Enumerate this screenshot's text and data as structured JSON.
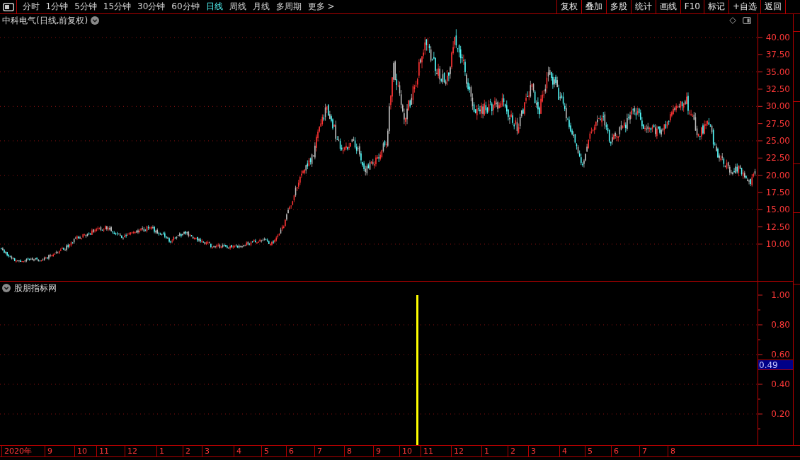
{
  "toolbar": {
    "tabs": [
      {
        "label": "分时",
        "selected": false
      },
      {
        "label": "1分钟",
        "selected": false
      },
      {
        "label": "5分钟",
        "selected": false
      },
      {
        "label": "15分钟",
        "selected": false
      },
      {
        "label": "30分钟",
        "selected": false
      },
      {
        "label": "60分钟",
        "selected": false
      },
      {
        "label": "日线",
        "selected": true
      },
      {
        "label": "周线",
        "selected": false
      },
      {
        "label": "月线",
        "selected": false
      },
      {
        "label": "多周期",
        "selected": false
      },
      {
        "label": "更多 >",
        "selected": false
      }
    ],
    "buttons": [
      "复权",
      "叠加",
      "多股",
      "统计",
      "画线",
      "F10",
      "标记",
      "+自选",
      "返回"
    ]
  },
  "main_chart": {
    "title": "中科电气(日线,前复权)",
    "price_axis": [
      "40.00",
      "37.50",
      "35.00",
      "32.50",
      "30.00",
      "27.50",
      "25.00",
      "22.50",
      "20.00",
      "17.50",
      "15.00",
      "12.50",
      "10.00"
    ]
  },
  "indicator_panel": {
    "title": "股朋指标网",
    "axis": [
      "1.00",
      "0.80",
      "0.60",
      "0.40",
      "0.20"
    ],
    "readout": "0.49"
  },
  "time_axis": [
    "2020年",
    "9",
    "10",
    "11",
    "12",
    "1",
    "2",
    "3",
    "4",
    "5",
    "6",
    "7",
    "8",
    "9",
    "10",
    "11",
    "12",
    "1",
    "2",
    "3",
    "4",
    "5",
    "6",
    "7",
    "8"
  ]
}
